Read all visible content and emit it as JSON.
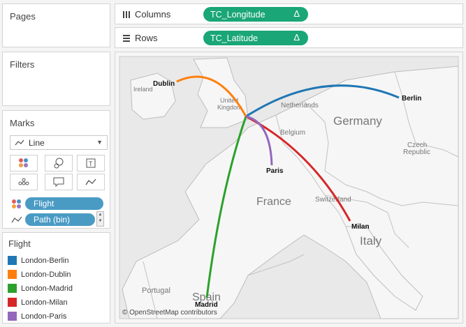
{
  "panels": {
    "pages": "Pages",
    "filters": "Filters",
    "marks": "Marks"
  },
  "shelves": {
    "columns": {
      "label": "Columns",
      "pill": "TC_Longitude",
      "delta": "Δ"
    },
    "rows": {
      "label": "Rows",
      "pill": "TC_Latitude",
      "delta": "Δ"
    }
  },
  "marks": {
    "type": "Line",
    "pills": [
      {
        "label": "Flight",
        "icon": "color-dots-icon"
      },
      {
        "label": "Path (bin)",
        "icon": "path-icon"
      }
    ]
  },
  "legend": {
    "title": "Flight",
    "items": [
      {
        "label": "London-Berlin",
        "color": "#1f77b4"
      },
      {
        "label": "London-Dublin",
        "color": "#ff7f0e"
      },
      {
        "label": "London-Madrid",
        "color": "#2ca02c"
      },
      {
        "label": "London-Milan",
        "color": "#d62728"
      },
      {
        "label": "London-Paris",
        "color": "#9467bd"
      }
    ]
  },
  "map": {
    "cities": {
      "dublin": "Dublin",
      "berlin": "Berlin",
      "paris": "Paris",
      "milan": "Milan",
      "madrid": "Madrid"
    },
    "countries": {
      "ireland": "Ireland",
      "uk1": "United",
      "uk2": "Kingdom",
      "netherlands": "Netherlands",
      "germany": "Germany",
      "belgium": "Belgium",
      "czech1": "Czech",
      "czech2": "Republic",
      "france": "France",
      "switzerland": "Switzerland",
      "italy": "Italy",
      "spain": "Spain",
      "portugal": "Portugal"
    },
    "attribution": "© OpenStreetMap contributors"
  }
}
